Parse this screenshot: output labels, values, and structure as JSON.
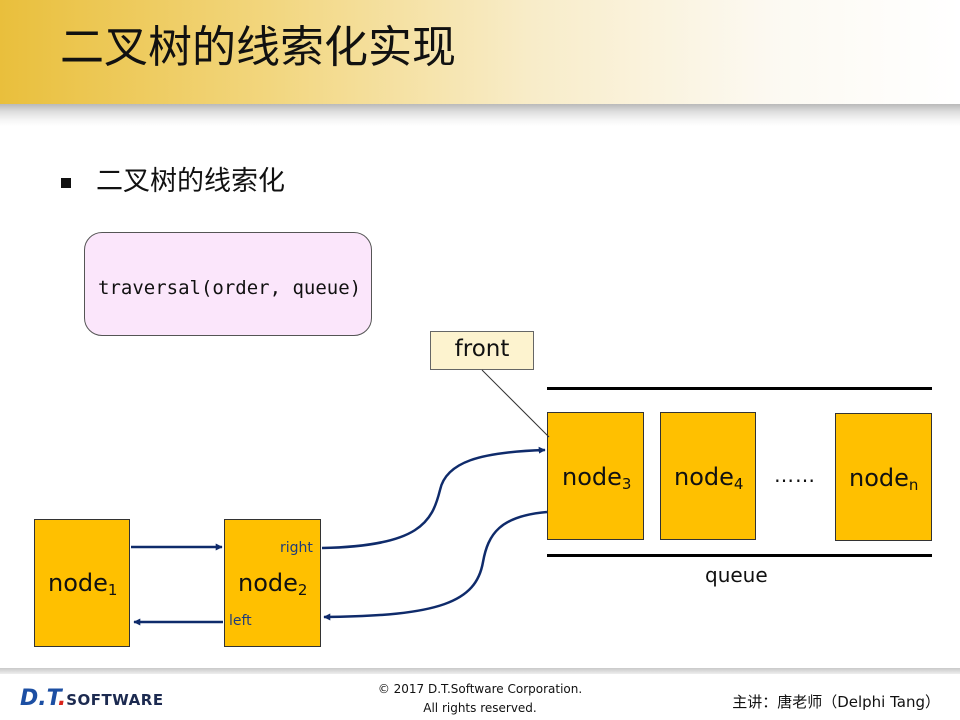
{
  "slide": {
    "title": "二叉树的线索化实现",
    "bullet": "二叉树的线索化"
  },
  "code_box": {
    "text": "traversal(order, queue)"
  },
  "diagram": {
    "front_label": "front",
    "queue_label": "queue",
    "ellipsis": "……",
    "node_base": "node",
    "nodes": [
      {
        "sub": "1"
      },
      {
        "sub": "2"
      },
      {
        "sub": "3"
      },
      {
        "sub": "4"
      },
      {
        "sub": "n"
      }
    ],
    "right_label": "right",
    "left_label": "left"
  },
  "colors": {
    "node_fill": "#ffc000",
    "arrow": "#0f2b6b",
    "code_box_fill": "#fbe6fb",
    "front_box_fill": "#fdf3cf"
  },
  "footer": {
    "logo_main": "D.T",
    "logo_dot": ".",
    "logo_sub": "SOFTWARE",
    "copyright_line1": "© 2017 D.T.Software Corporation.",
    "copyright_line2": "All rights reserved.",
    "presenter": "主讲：唐老师（Delphi Tang）"
  }
}
